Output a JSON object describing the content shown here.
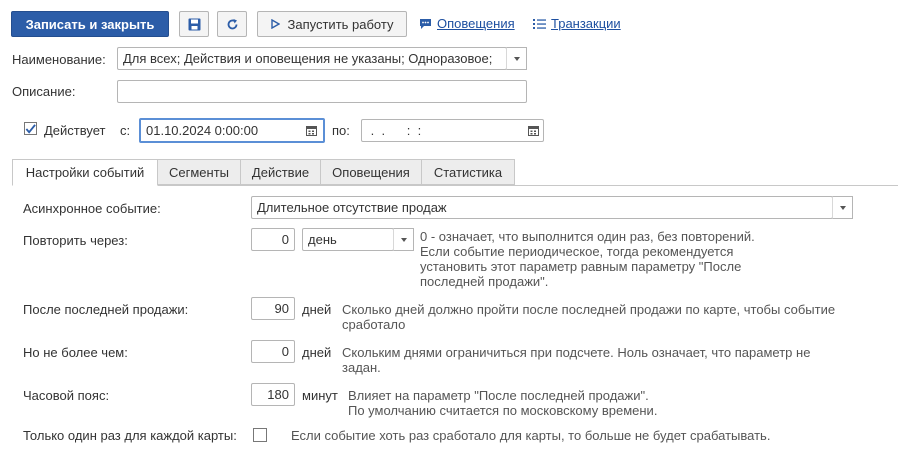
{
  "toolbar": {
    "save_close_label": "Записать и закрыть",
    "run_label": "Запустить работу",
    "notifications_link": "Оповещения",
    "transactions_link": "Транзакции"
  },
  "form": {
    "name_label": "Наименование:",
    "name_value": "Для всех; Действия и оповещения не указаны; Одноразовое;",
    "description_label": "Описание:",
    "description_value": "",
    "active_label": "Действует",
    "active_checked": true,
    "from_label": "с:",
    "from_value": "01.10.2024  0:00:00",
    "to_label": "по:",
    "to_value": " .  .      :  :  "
  },
  "tabs": [
    {
      "label": "Настройки событий",
      "active": true
    },
    {
      "label": "Сегменты",
      "active": false
    },
    {
      "label": "Действие",
      "active": false
    },
    {
      "label": "Оповещения",
      "active": false
    },
    {
      "label": "Статистика",
      "active": false
    }
  ],
  "settings": {
    "async_event_label": "Асинхронное событие:",
    "async_event_value": "Длительное отсутствие продаж",
    "repeat_label": "Повторить через:",
    "repeat_value": "0",
    "repeat_unit": "день",
    "repeat_hint_1": "0 - означает, что выполнится один раз, без повторений.",
    "repeat_hint_2": "Если событие периодическое, тогда рекомендуется",
    "repeat_hint_3": "установить этот параметр равным параметру \"После",
    "repeat_hint_4": "последней продажи\".",
    "after_sale_label": "После последней продажи:",
    "after_sale_value": "90",
    "after_sale_unit": "дней",
    "after_sale_hint_1": "Сколько дней должно пройти после последней продажи по карте, чтобы событие",
    "after_sale_hint_2": "сработало",
    "max_label": "Но не более чем:",
    "max_value": "0",
    "max_unit": "дней",
    "max_hint_1": "Скольким днями ограничиться при подсчете. Ноль означает, что параметр не",
    "max_hint_2": "задан.",
    "tz_label": "Часовой пояс:",
    "tz_value": "180",
    "tz_unit": "минут",
    "tz_hint_1": "Влияет на параметр \"После последней продажи\".",
    "tz_hint_2": "По умолчанию считается по московскому времени.",
    "once_label": "Только один раз для каждой карты:",
    "once_checked": false,
    "once_hint": "Если событие хоть раз сработало для карты, то больше не будет срабатывать."
  },
  "colors": {
    "primary": "#2c5da8",
    "link": "#1d4fa0",
    "focus": "#5b8fd6"
  }
}
